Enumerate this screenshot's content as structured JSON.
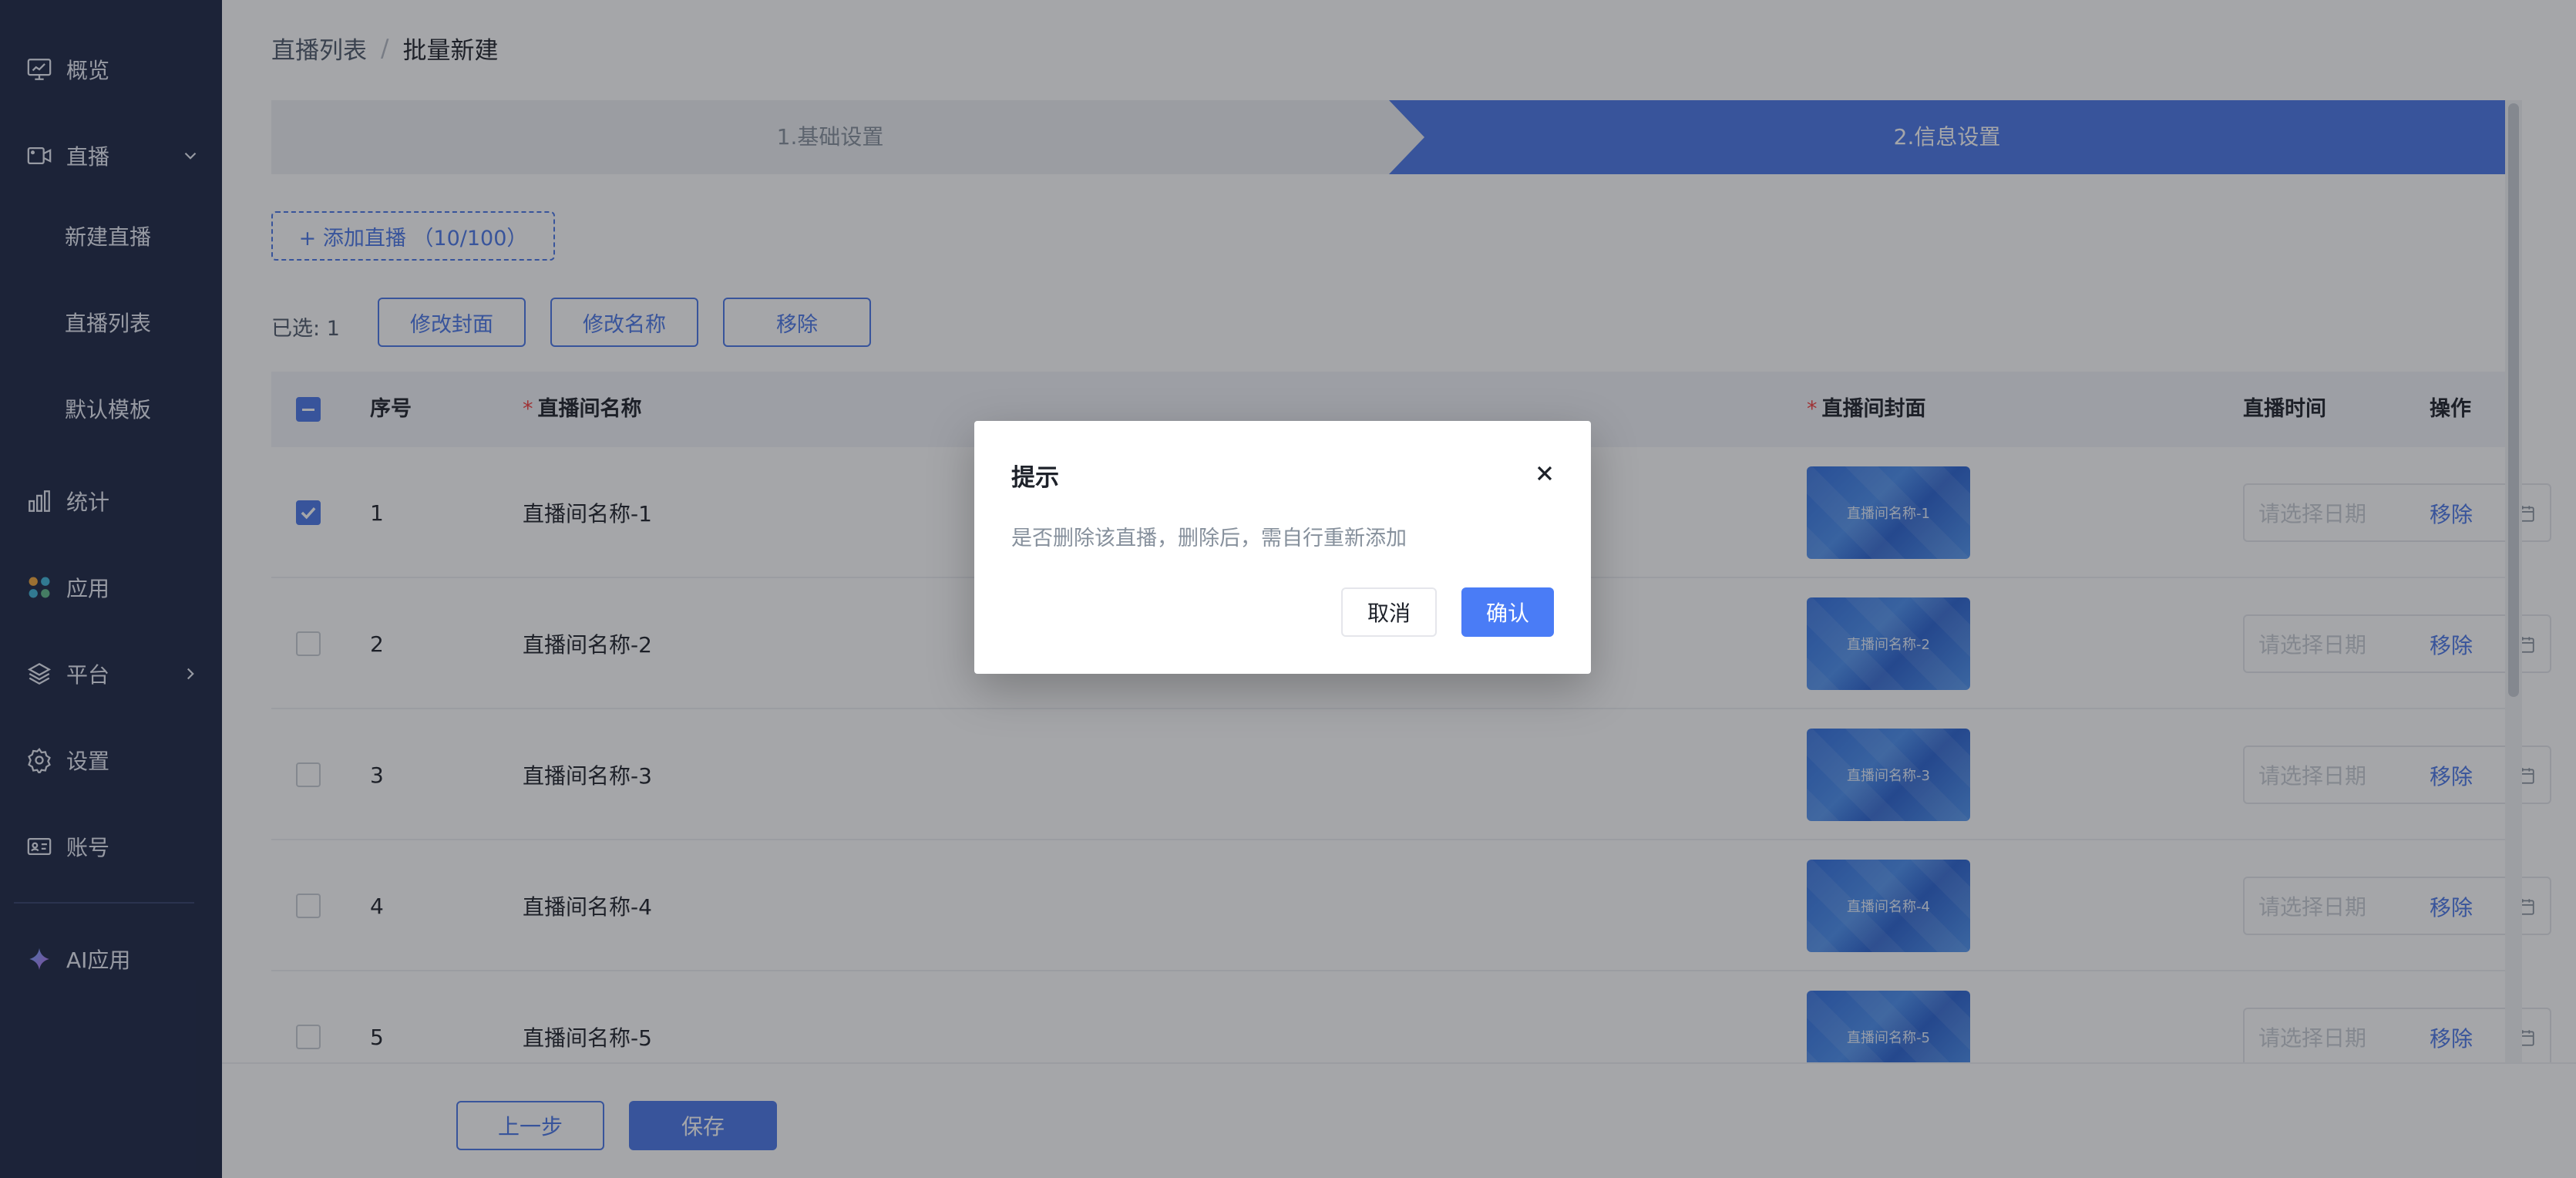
{
  "sidebar": {
    "items": [
      {
        "label": "概览",
        "icon": "monitor-icon"
      },
      {
        "label": "直播",
        "icon": "video-camera-icon"
      },
      {
        "label": "新建直播"
      },
      {
        "label": "直播列表"
      },
      {
        "label": "默认模板"
      },
      {
        "label": "统计",
        "icon": "bar-chart-icon"
      },
      {
        "label": "应用",
        "icon": "apps-grid-icon"
      },
      {
        "label": "平台",
        "icon": "layers-icon"
      },
      {
        "label": "设置",
        "icon": "gear-icon"
      },
      {
        "label": "账号",
        "icon": "id-card-icon"
      },
      {
        "label": "AI应用",
        "icon": "sparkle-icon"
      }
    ]
  },
  "breadcrumb": {
    "parent": "直播列表",
    "separator": "/",
    "current": "批量新建"
  },
  "steps": [
    {
      "label": "1.基础设置",
      "active": false
    },
    {
      "label": "2.信息设置",
      "active": true
    }
  ],
  "toolbar": {
    "add_label": "+ 添加直播 （10/100）",
    "selected_label": "已选:",
    "selected_count": "1",
    "edit_cover": "修改封面",
    "edit_name": "修改名称",
    "remove": "移除"
  },
  "table": {
    "headers": {
      "index": "序号",
      "name": "直播间名称",
      "cover": "直播间封面",
      "time": "直播时间",
      "action": "操作"
    },
    "required_mark": "*",
    "date_placeholder": "请选择日期",
    "rows": [
      {
        "index": "1",
        "name": "直播间名称-1",
        "cover_text": "直播间名称-1",
        "checked": true,
        "action": "移除"
      },
      {
        "index": "2",
        "name": "直播间名称-2",
        "cover_text": "直播间名称-2",
        "checked": false,
        "action": "移除"
      },
      {
        "index": "3",
        "name": "直播间名称-3",
        "cover_text": "直播间名称-3",
        "checked": false,
        "action": "移除"
      },
      {
        "index": "4",
        "name": "直播间名称-4",
        "cover_text": "直播间名称-4",
        "checked": false,
        "action": "移除"
      },
      {
        "index": "5",
        "name": "直播间名称-5",
        "cover_text": "直播间名称-5",
        "checked": false,
        "action": "移除"
      }
    ]
  },
  "footer": {
    "prev": "上一步",
    "save": "保存"
  },
  "modal": {
    "title": "提示",
    "message": "是否删除该直播，删除后，需自行重新添加",
    "cancel": "取消",
    "confirm": "确认"
  },
  "colors": {
    "primary": "#4a77e8",
    "sidebar_bg": "#1b2544",
    "danger": "#f53f3f"
  }
}
